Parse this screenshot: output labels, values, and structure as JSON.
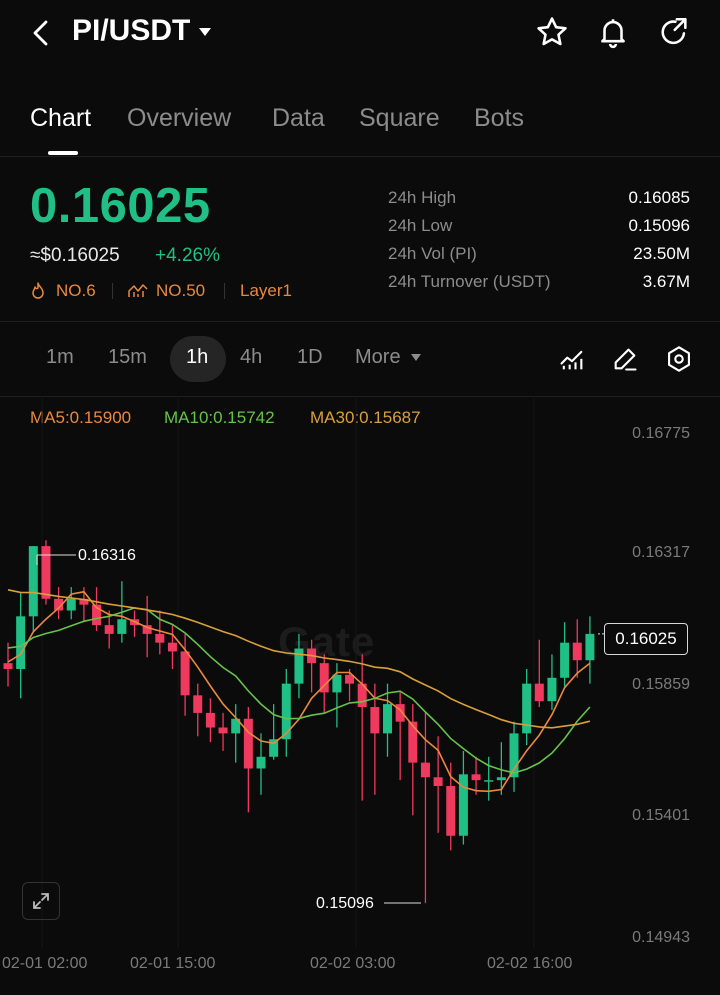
{
  "header": {
    "pair": "PI/USDT"
  },
  "icons": {
    "back": "back-chevron-icon",
    "dropdown": "caret-down-icon",
    "favorite": "star-icon",
    "alert": "bell-icon",
    "share": "share-icon",
    "indicators": "indicator-chart-icon",
    "draw": "pencil-icon",
    "settings": "hexagon-gear-icon",
    "fullscreen": "expand-icon"
  },
  "tabs": [
    "Chart",
    "Overview",
    "Data",
    "Square",
    "Bots"
  ],
  "active_tab": "Chart",
  "ticker": {
    "last_price": "0.16025",
    "usd_value": "≈$0.16025",
    "change": "+4.26%",
    "tags": [
      "NO.6",
      "NO.50",
      "Layer1"
    ]
  },
  "stats": [
    {
      "label": "24h  High",
      "value": "0.16085"
    },
    {
      "label": "24h  Low",
      "value": "0.15096"
    },
    {
      "label": "24h  Vol (PI)",
      "value": "23.50M"
    },
    {
      "label": "24h  Turnover (USDT)",
      "value": "3.67M"
    }
  ],
  "timeframes": [
    "1m",
    "15m",
    "1h",
    "4h",
    "1D",
    "More"
  ],
  "active_timeframe": "1h",
  "chart_overlay": {
    "ma5": "MA5:0.15900",
    "ma10": "MA10:0.15742",
    "ma30": "MA30:0.15687",
    "current_price_tag": "0.16025",
    "high_marker": "0.16316",
    "low_marker": "0.15096",
    "watermark": "Gate"
  },
  "colors": {
    "up": "#1fbf85",
    "down": "#f0395e",
    "ma5": "#e9893e",
    "ma10": "#65c34a",
    "ma30": "#d9a03a",
    "tag": "#e9893e"
  },
  "chart_data": {
    "type": "candlestick",
    "interval": "1h",
    "y_ticks": [
      "0.16775",
      "0.16317",
      "0.15859",
      "0.15401",
      "0.14943"
    ],
    "ylim": [
      0.14943,
      0.16775
    ],
    "x_ticks": [
      "02-01 02:00",
      "02-01 15:00",
      "02-02 03:00",
      "02-02 16:00"
    ],
    "candles": [
      [
        0.1592,
        0.159,
        0.1599,
        0.1584
      ],
      [
        0.159,
        0.1608,
        0.1616,
        0.158
      ],
      [
        0.1608,
        0.1632,
        0.1632,
        0.1603
      ],
      [
        0.1632,
        0.1614,
        0.1634,
        0.1612
      ],
      [
        0.1614,
        0.161,
        0.1618,
        0.1607
      ],
      [
        0.161,
        0.1614,
        0.1618,
        0.1607
      ],
      [
        0.1614,
        0.1612,
        0.1618,
        0.1606
      ],
      [
        0.1612,
        0.1605,
        0.1618,
        0.1603
      ],
      [
        0.1605,
        0.1602,
        0.161,
        0.1597
      ],
      [
        0.1602,
        0.1607,
        0.162,
        0.1599
      ],
      [
        0.1607,
        0.1605,
        0.161,
        0.1601
      ],
      [
        0.1605,
        0.1602,
        0.1615,
        0.1594
      ],
      [
        0.1602,
        0.1599,
        0.161,
        0.1595
      ],
      [
        0.1599,
        0.1596,
        0.1605,
        0.159
      ],
      [
        0.1596,
        0.1581,
        0.1602,
        0.1574
      ],
      [
        0.1581,
        0.1575,
        0.1585,
        0.1567
      ],
      [
        0.1575,
        0.157,
        0.158,
        0.1565
      ],
      [
        0.157,
        0.1568,
        0.1575,
        0.1562
      ],
      [
        0.1568,
        0.1573,
        0.1578,
        0.1558
      ],
      [
        0.1573,
        0.1556,
        0.1577,
        0.1541
      ],
      [
        0.1556,
        0.156,
        0.1568,
        0.1547
      ],
      [
        0.156,
        0.1566,
        0.1578,
        0.1559
      ],
      [
        0.1566,
        0.1585,
        0.159,
        0.156
      ],
      [
        0.1585,
        0.1597,
        0.1602,
        0.158
      ],
      [
        0.1597,
        0.1592,
        0.16,
        0.1582
      ],
      [
        0.1592,
        0.1582,
        0.1595,
        0.1575
      ],
      [
        0.1582,
        0.1588,
        0.1592,
        0.157
      ],
      [
        0.1588,
        0.1585,
        0.159,
        0.1579
      ],
      [
        0.1585,
        0.1577,
        0.1595,
        0.1545
      ],
      [
        0.1577,
        0.1568,
        0.1585,
        0.1547
      ],
      [
        0.1568,
        0.1578,
        0.1585,
        0.156
      ],
      [
        0.1578,
        0.1572,
        0.1582,
        0.1552
      ],
      [
        0.1572,
        0.1558,
        0.1578,
        0.154
      ],
      [
        0.1558,
        0.1553,
        0.1575,
        0.151
      ],
      [
        0.1553,
        0.155,
        0.1567,
        0.1534
      ],
      [
        0.155,
        0.1533,
        0.1558,
        0.1528
      ],
      [
        0.1533,
        0.1554,
        0.1562,
        0.153
      ],
      [
        0.1554,
        0.1552,
        0.156,
        0.1547
      ],
      [
        0.1552,
        0.1552,
        0.156,
        0.1545
      ],
      [
        0.1552,
        0.1553,
        0.1565,
        0.1547
      ],
      [
        0.1553,
        0.1568,
        0.1572,
        0.1548
      ],
      [
        0.1568,
        0.1585,
        0.159,
        0.1564
      ],
      [
        0.1585,
        0.1579,
        0.16,
        0.1577
      ],
      [
        0.1579,
        0.1587,
        0.1595,
        0.1576
      ],
      [
        0.1587,
        0.1599,
        0.1606,
        0.1584
      ],
      [
        0.1599,
        0.1593,
        0.1607,
        0.1587
      ],
      [
        0.1593,
        0.1602,
        0.1608,
        0.1585
      ]
    ],
    "ma5_last": 0.159,
    "ma10_last": 0.15742,
    "ma30_last": 0.15687
  }
}
